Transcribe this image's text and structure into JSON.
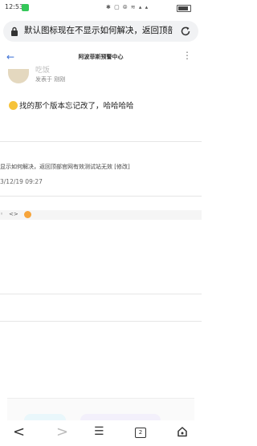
{
  "status": {
    "time": "12:53",
    "icons": "✱ ▢ ⦾ ≋ ▴ ▴"
  },
  "browser": {
    "url_text": "默认图标现在不显示如何解决，返回顶部官网有效测试站无效"
  },
  "page": {
    "title": "阿波菲斯预警中心",
    "back": "←",
    "menu": "⋮"
  },
  "post": {
    "nickname": "吃饭",
    "poster_label": "发表于",
    "poster_name": "刚刚",
    "content": "找的那个版本忘记改了，哈哈哈哈"
  },
  "reply": {
    "note": "显示如何解决，返回顶部官网有效测试站无效 [修改]",
    "date": "3/12/19 09:27"
  },
  "toolbar": {
    "item1": "◦",
    "item2": "<>"
  },
  "nav": {
    "back": "<",
    "forward": ">",
    "menu": "☰",
    "tabs_count": "2"
  }
}
